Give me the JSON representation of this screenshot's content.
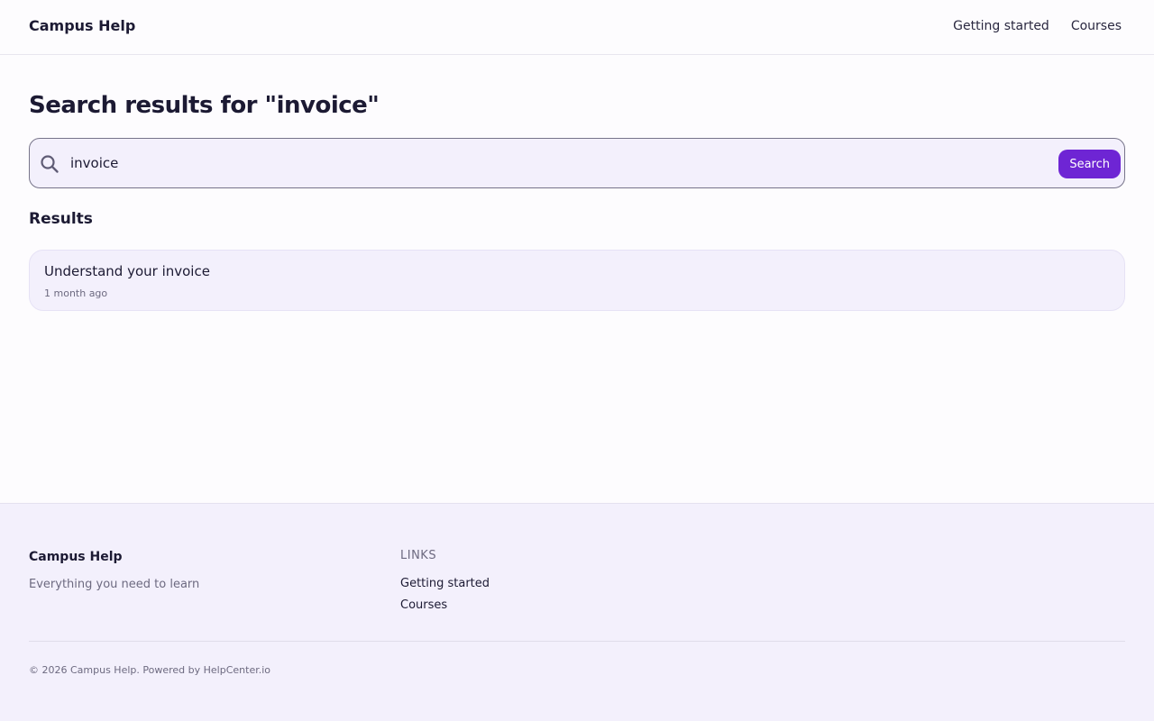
{
  "header": {
    "brand": "Campus Help",
    "nav": [
      {
        "label": "Getting started"
      },
      {
        "label": "Courses"
      }
    ]
  },
  "page": {
    "title": "Search results for \"invoice\""
  },
  "search": {
    "value": "invoice",
    "button_label": "Search",
    "icon": "search-icon"
  },
  "results": {
    "heading": "Results",
    "items": [
      {
        "title": "Understand your invoice",
        "meta": "1 month ago"
      }
    ]
  },
  "footer": {
    "brand": "Campus Help",
    "tagline": "Everything you need to learn",
    "links_heading": "LINKS",
    "links": [
      {
        "label": "Getting started"
      },
      {
        "label": "Courses"
      }
    ],
    "copyright": "© 2026 Campus Help. Powered by HelpCenter.io"
  },
  "colors": {
    "accent": "#6e25d4",
    "surface": "#f3f0fc",
    "text": "#1c1a33",
    "muted": "#6d6a80"
  }
}
